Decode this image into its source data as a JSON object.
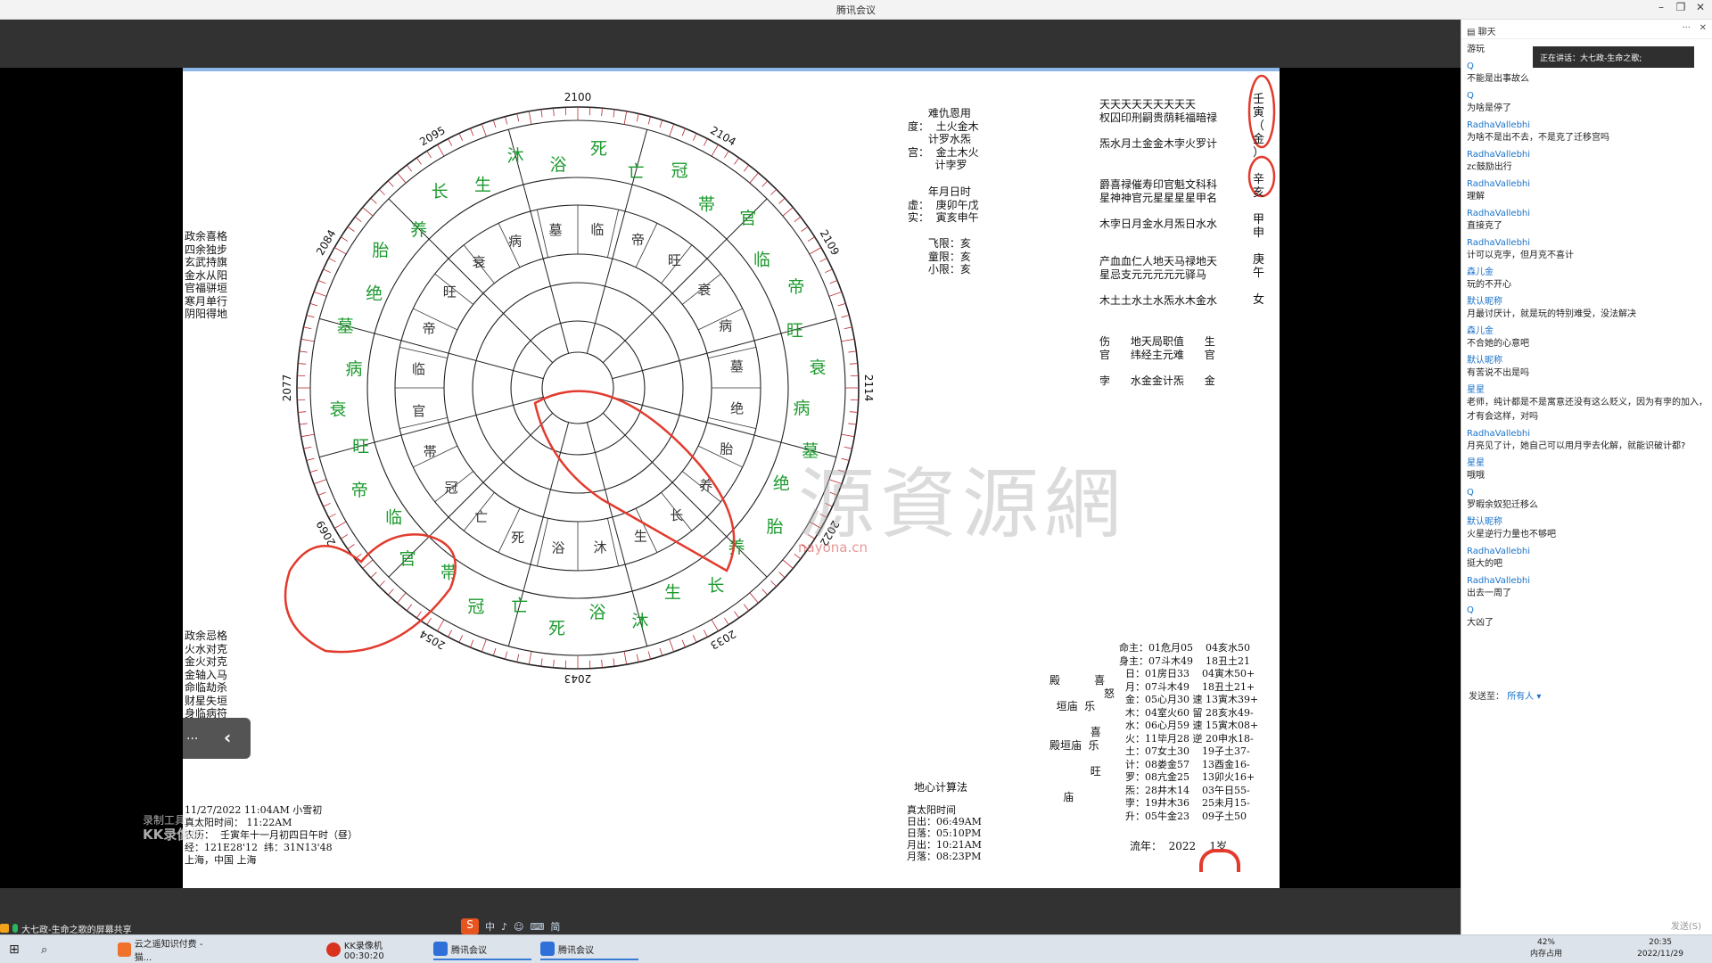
{
  "window": {
    "title": "腾讯会议"
  },
  "chart": {
    "years": {
      "top": "2100",
      "top_left": "2095",
      "top_right": "2104",
      "left_upper": "2084",
      "left": "2077",
      "left_lower": "2069",
      "bottom_left": "2054",
      "bottom": "2043",
      "bottom_right": "2033",
      "right_lower": "2022",
      "right": "2114",
      "right_upper": "2109"
    },
    "left_top_col": "政余喜格\n四余独步\n玄武持旗\n金水从阳\n官福骈垣\n寒月单行\n阴阳得地",
    "left_bottom_col": "政余忌格\n火水对克\n金火对克\n金轴入马\n命临劫杀\n财星失垣\n身临病符",
    "top_center_col": "      难仇恩用\n度：  土火金木\n      计罗水炁\n宫：  金土木火\n        计孛罗",
    "center_right_col": "      年月日时\n虚：  庚卯午戊\n实：  寅亥申午\n\n      飞限：亥\n      童限：亥\n      小限：亥",
    "right_block_1": "天天天天天天天天天\n权囚印刑嗣贵荫耗福暗禄\n\n炁水月土金金木孛火罗计",
    "right_block_2": "爵喜禄催寿印官魁文科科\n星神神官元星星星星甲名\n\n木孛日月金水月炁日水水",
    "right_block_3": "产血血仁人地天马禄地天\n星忌支元元元元元驿马\n\n木土土水土水炁水木金水",
    "right_block_4": "伤      地天局职值      生\n官      纬经主元难      官\n\n孛      水金金计炁      金",
    "right_edge": "壬\n寅\n（\n金\n）\n\n辛\n亥\n\n甲\n申\n\n庚\n午\n\n女",
    "stars_table": "命主：01危月05    04亥水50\n身主：07斗木49    18丑土21\n  日：01房日33    04寅木50+\n  月：07斗木49    18丑土21+\n  金：05心月30 速 13寅木39+\n  木：04室火60 留 28亥水49-\n  水：06心月59 速 15寅木08+\n  火：11毕月28 逆 20申水18-\n  土：07女土30    19子土37-\n  计：08娄金57    13酉金16-\n  罗：08亢金25    13卯火16+\n  炁：28井木14    03午日55-\n  孛：19井木36    25未月15-\n  升：05牛金23    09子土50",
    "dignities": "殿          喜\n                怒\n  垣庙  乐\n\n            喜\n殿垣庙  乐\n\n            旺\n\n    庙",
    "bottom_left_info": "11/27/2022 11:04AM 小雪初\n真太阳时间： 11:22AM\n农历：  壬寅年十一月初四日午时（昼）\n经：121E28'12  纬：31N13'48\n上海，中国 上海",
    "method_label": "地心计算法",
    "sun_info": "真太阳时间\n日出：06:49AM\n日落：05:10PM\n月出：10:21AM\n月落：08:23PM",
    "flow_year": "流年：  2022    1岁",
    "watermark": "源資源網",
    "watermark_sub": "nayona.cn"
  },
  "overlay": {
    "collapse_dots": "...",
    "collapse_chevron": "‹"
  },
  "kk_watermark": {
    "line1": "录制工具",
    "line2": "KK录像机"
  },
  "share_bar": {
    "label": "大七政-生命之歌的屏幕共享"
  },
  "ime": [
    "中",
    "♪",
    "☺",
    "⌨",
    "简"
  ],
  "chat": {
    "header": "聊天",
    "speaking": "正在讲话：大七政-生命之歌;",
    "messages": [
      {
        "name": "",
        "text": "游玩"
      },
      {
        "name": "Q",
        "text": "不能是出事故么"
      },
      {
        "name": "Q",
        "text": "为啥是停了"
      },
      {
        "name": "RadhaVallebhi",
        "text": "为啥不是出不去，不是克了迁移宫吗"
      },
      {
        "name": "RadhaVallebhi",
        "text": "zc鼓励出行"
      },
      {
        "name": "RadhaVallebhi",
        "text": "理解"
      },
      {
        "name": "RadhaVallebhi",
        "text": "直接克了"
      },
      {
        "name": "RadhaVallebhi",
        "text": "计可以克孛，但月克不喜计"
      },
      {
        "name": "森儿金",
        "text": "玩的不开心"
      },
      {
        "name": "默认昵称",
        "text": "月最讨厌计，就是玩的特别难受，没法解决"
      },
      {
        "name": "森儿金",
        "text": "不合她的心意吧"
      },
      {
        "name": "默认昵称",
        "text": "有苦说不出是吗"
      },
      {
        "name": "星星",
        "text": "老师，纯计都是不是寓意还没有这么贬义，因为有孛的加入，才有会这样，对吗"
      },
      {
        "name": "RadhaVallebhi",
        "text": "月亮见了计，她自己可以用月孛去化解，就能识破计都?"
      },
      {
        "name": "星星",
        "text": "哦哦"
      },
      {
        "name": "Q",
        "text": "罗暇余奴犯迁移么"
      },
      {
        "name": "默认昵称",
        "text": "火星逆行力量也不够吧"
      },
      {
        "name": "RadhaVallebhi",
        "text": "挺大的吧"
      },
      {
        "name": "RadhaVallebhi",
        "text": "出去一周了"
      },
      {
        "name": "Q",
        "text": "大凶了"
      }
    ],
    "send_to_label": "发送至：",
    "send_to_value": "所有人",
    "send_button": "发送(S)"
  },
  "taskbar": {
    "apps": [
      {
        "label": "云之遥知识付费 - 猫..."
      },
      {
        "label": "KK录像机 00:30:20"
      },
      {
        "label": "腾讯会议"
      },
      {
        "label": "腾讯会议"
      }
    ],
    "mem_pct": "42%",
    "mem_label": "内存占用",
    "time": "20:35",
    "date": "2022/11/29"
  }
}
